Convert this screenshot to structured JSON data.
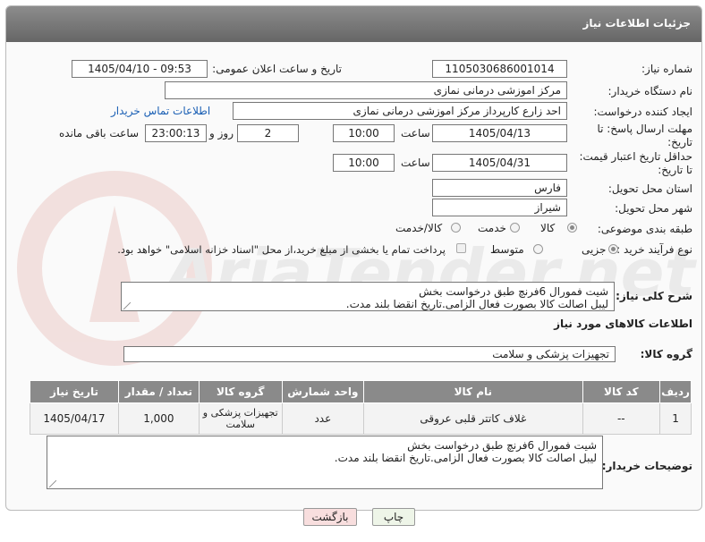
{
  "header": {
    "title": "جزئیات اطلاعات نیاز"
  },
  "fields": {
    "need_number": {
      "label": "شماره نیاز:",
      "value": "1105030686001014"
    },
    "announce": {
      "label": "تاریخ و ساعت اعلان عمومی:",
      "value": "1405/04/10 - 09:53"
    },
    "buyer_org": {
      "label": "نام دستگاه خریدار:",
      "value": "مرکز اموزشی درمانی نمازی"
    },
    "creator": {
      "label": "ایجاد کننده درخواست:",
      "value": "احد زارع کارپرداز مرکز اموزشی درمانی نمازی",
      "link": "اطلاعات تماس خریدار"
    },
    "deadline": {
      "label_line1": "مهلت ارسال پاسخ: تا",
      "label_line2": "تاریخ:",
      "date": "1405/04/13",
      "time_label": "ساعت",
      "time": "10:00",
      "days": "2",
      "days_label": "روز و",
      "remaining": "23:00:13",
      "remaining_label": "ساعت باقی مانده"
    },
    "price_validity": {
      "label_line1": "حداقل تاریخ اعتبار قیمت:",
      "label_line2": "تا تاریخ:",
      "date": "1405/04/31",
      "time_label": "ساعت",
      "time": "10:00"
    },
    "province": {
      "label": "استان محل تحویل:",
      "value": "فارس"
    },
    "city": {
      "label": "شهر محل تحویل:",
      "value": "شیراز"
    },
    "category": {
      "label": "طبقه بندی موضوعی:",
      "options": [
        "کالا",
        "خدمت",
        "کالا/خدمت"
      ],
      "selected": "کالا"
    },
    "process": {
      "label": "نوع فرآیند خرید :",
      "options": [
        "جزیی",
        "متوسط"
      ],
      "selected": "جزیی",
      "note": "پرداخت تمام یا بخشی از مبلغ خرید،از محل \"اسناد خزانه اسلامی\" خواهد بود."
    }
  },
  "summary": {
    "label": "شرح کلی نیاز:",
    "line1": "شیت فمورال 6فرنچ طبق درخواست بخش",
    "line2": "لیبل اصالت کالا بصورت فعال الزامی.تاریخ انقضا بلند مدت."
  },
  "goods_section": {
    "title": "اطلاعات کالاهای مورد نیاز"
  },
  "goods_group": {
    "label": "گروه کالا:",
    "value": "تجهیزات پزشکی و سلامت"
  },
  "table": {
    "headers": [
      "ردیف",
      "کد کالا",
      "نام کالا",
      "واحد شمارش",
      "گروه کالا",
      "تعداد / مقدار",
      "تاریخ نیاز"
    ],
    "rows": [
      [
        "1",
        "--",
        "غلاف کاتتر قلبی عروقی",
        "عدد",
        "تجهیزات پزشکی و سلامت",
        "1,000",
        "1405/04/17"
      ]
    ]
  },
  "buyer_notes": {
    "label": "توضیحات خریدار:",
    "line1": "شیت فمورال 6فرنچ طبق درخواست بخش",
    "line2": "لیبل اصالت کالا بصورت فعال الزامی.تاریخ انقضا بلند مدت."
  },
  "buttons": {
    "print": "چاپ",
    "back": "بازگشت"
  },
  "watermark": {
    "text": "AriaTender.net"
  },
  "colors": {
    "titlebar": "#777777",
    "link": "#1a5fb4",
    "back_button": "#f8dede",
    "print_button": "#eef5e8"
  }
}
